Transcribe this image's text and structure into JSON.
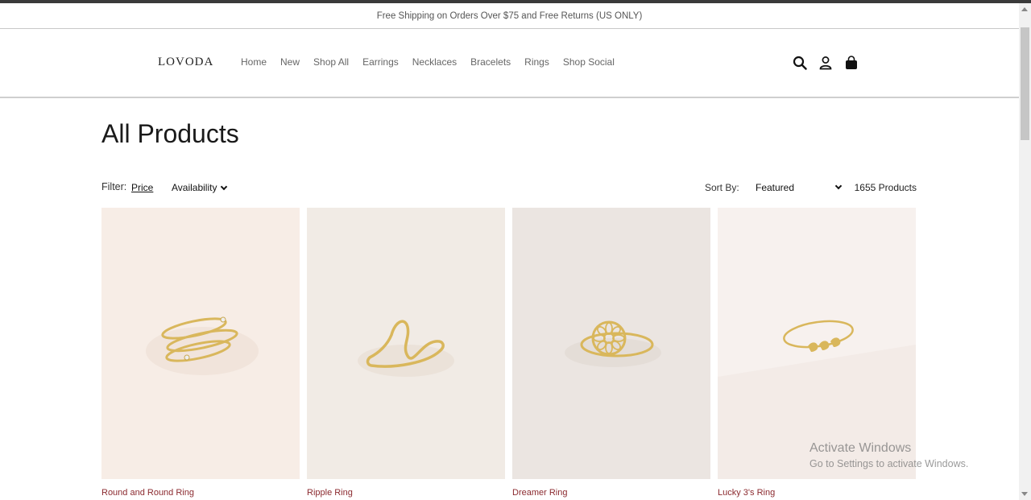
{
  "announcement": "Free Shipping on Orders Over $75 and Free Returns (US ONLY)",
  "brand": "LOVODA",
  "nav": [
    "Home",
    "New",
    "Shop All",
    "Earrings",
    "Necklaces",
    "Bracelets",
    "Rings",
    "Shop Social"
  ],
  "header_icons": [
    "search-icon",
    "account-icon",
    "cart-bag-icon"
  ],
  "page_title": "All Products",
  "filters": {
    "label": "Filter:",
    "price": "Price",
    "availability": "Availability"
  },
  "sort": {
    "label": "Sort By:",
    "selected": "Featured"
  },
  "product_count": "1655 Products",
  "products": [
    {
      "name": "Round and Round Ring",
      "bg": "#f7ede6"
    },
    {
      "name": "Ripple Ring",
      "bg": "#f1ebe5"
    },
    {
      "name": "Dreamer Ring",
      "bg": "#ebe5e1"
    },
    {
      "name": "Lucky 3's Ring",
      "bg": "#f7f1ee"
    }
  ],
  "watermark": {
    "line1": "Activate Windows",
    "line2": "Go to Settings to activate Windows."
  },
  "colors": {
    "product_name": "#8b2a2f",
    "gold": "#d9b75c"
  }
}
